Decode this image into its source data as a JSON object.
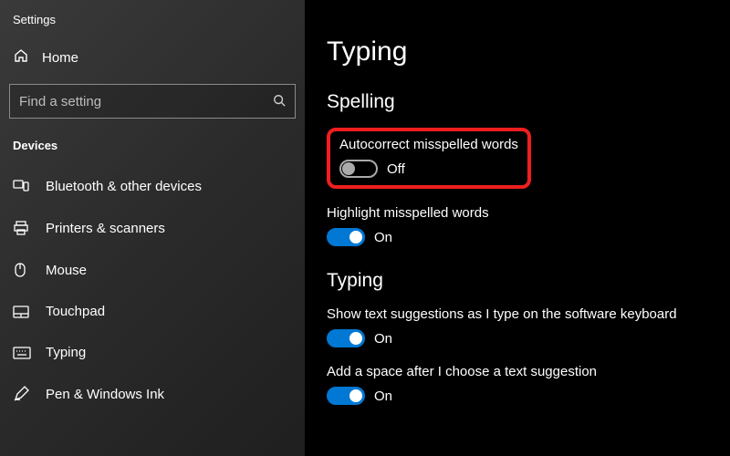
{
  "app_title": "Settings",
  "home_label": "Home",
  "search": {
    "placeholder": "Find a setting"
  },
  "section_label": "Devices",
  "nav": [
    {
      "label": "Bluetooth & other devices"
    },
    {
      "label": "Printers & scanners"
    },
    {
      "label": "Mouse"
    },
    {
      "label": "Touchpad"
    },
    {
      "label": "Typing"
    },
    {
      "label": "Pen & Windows Ink"
    }
  ],
  "page_title": "Typing",
  "groups": {
    "spelling": {
      "heading": "Spelling",
      "settings": [
        {
          "label": "Autocorrect misspelled words",
          "state": "Off"
        },
        {
          "label": "Highlight misspelled words",
          "state": "On"
        }
      ]
    },
    "typing": {
      "heading": "Typing",
      "settings": [
        {
          "label": "Show text suggestions as I type on the software keyboard",
          "state": "On"
        },
        {
          "label": "Add a space after I choose a text suggestion",
          "state": "On"
        }
      ]
    }
  },
  "annotation": {
    "color": "#ef1f1f"
  }
}
